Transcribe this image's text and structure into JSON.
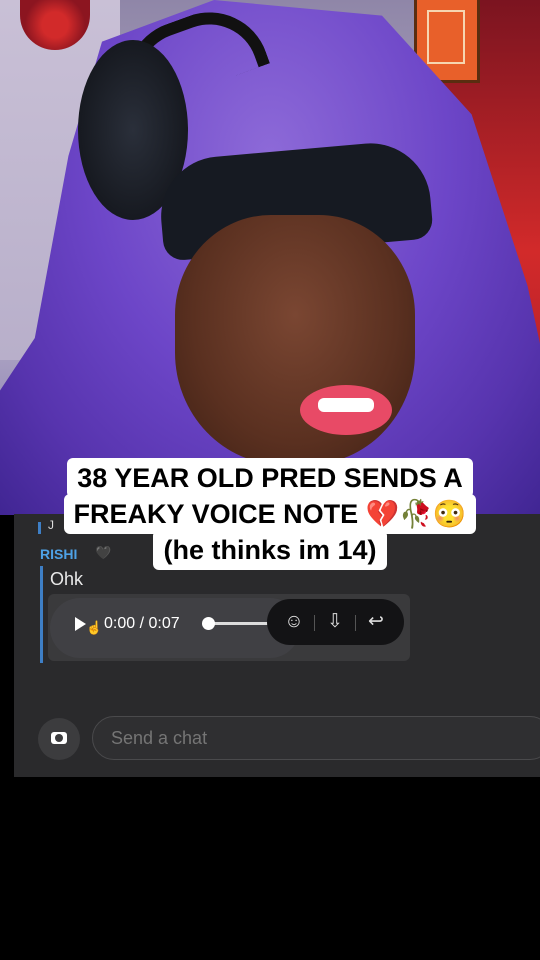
{
  "caption": {
    "line1": "38 YEAR OLD PRED SENDS A",
    "line2": "FREAKY VOICE NOTE 💔🥀😳",
    "line3": "(he thinks im 14)"
  },
  "chat": {
    "previous_sender_initial": "J",
    "sender_name": "RISHI",
    "sender_emoji": "🖤",
    "message_text": "Ohk",
    "voice_note": {
      "time": "0:00 / 0:07",
      "progress": 0
    },
    "actions": [
      "react-icon",
      "save-icon",
      "reply-icon"
    ],
    "input_placeholder": "Send a chat"
  },
  "colors": {
    "sender_accent": "#4ea2e6",
    "message_bar": "#3e7fc6",
    "panel_bg": "#2a2a2c"
  }
}
